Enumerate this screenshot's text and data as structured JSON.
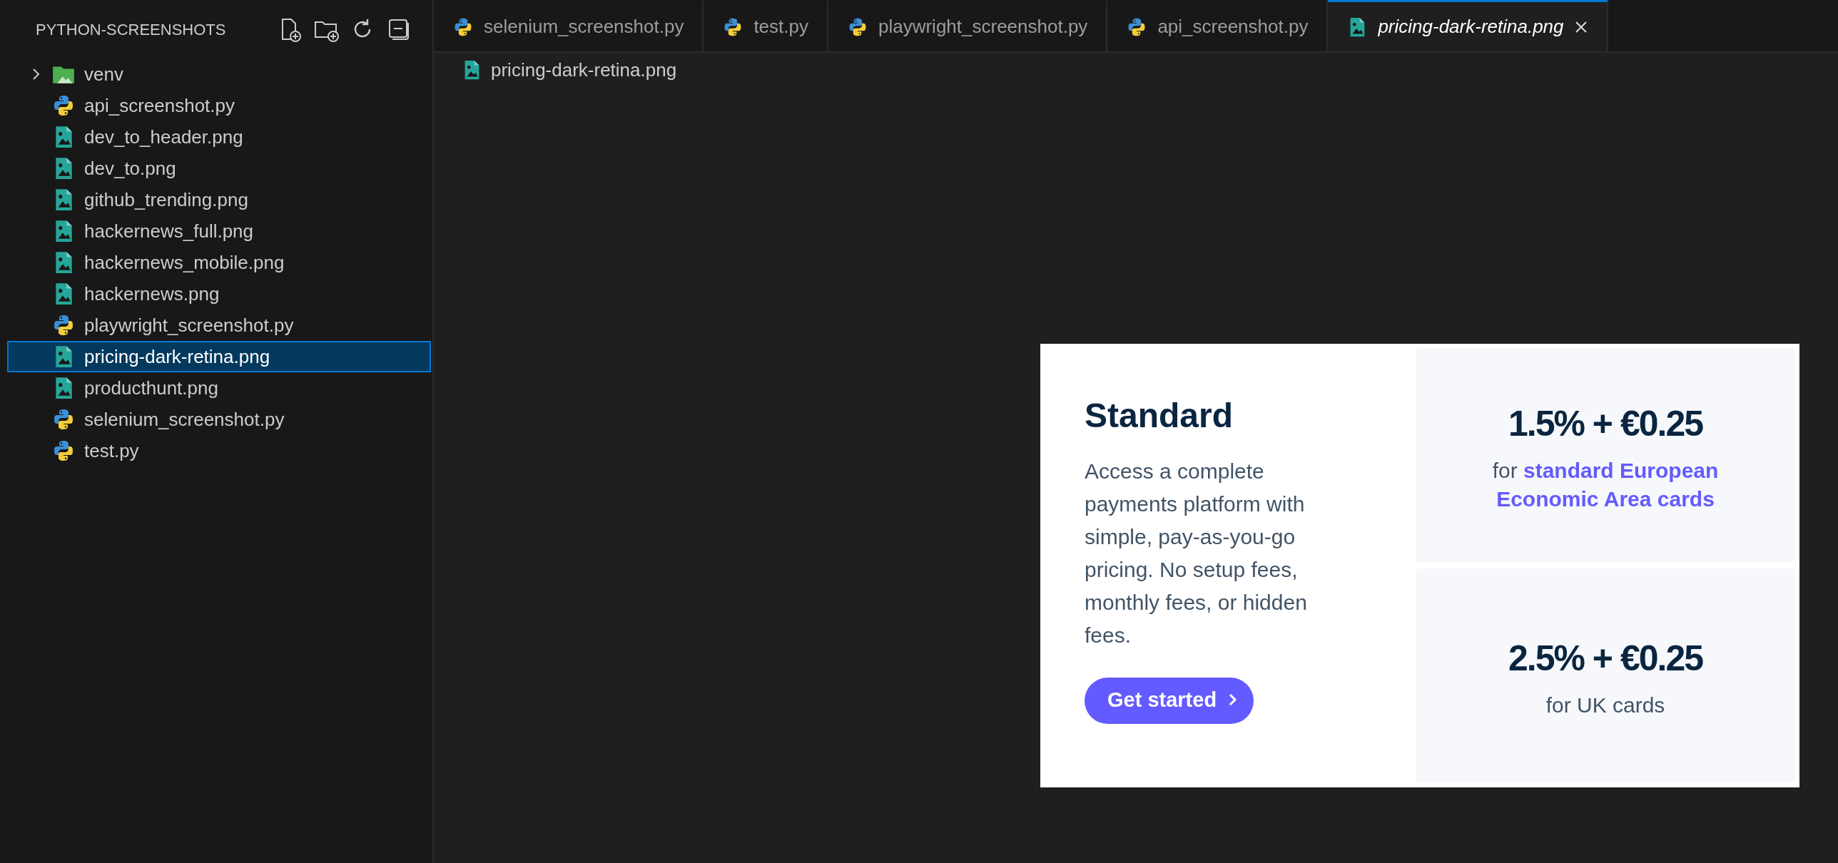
{
  "explorer": {
    "title": "PYTHON-SCREENSHOTS",
    "items": [
      {
        "name": "venv",
        "kind": "folder",
        "expanded": false,
        "selected": false
      },
      {
        "name": "api_screenshot.py",
        "kind": "python",
        "selected": false
      },
      {
        "name": "dev_to_header.png",
        "kind": "image",
        "selected": false
      },
      {
        "name": "dev_to.png",
        "kind": "image",
        "selected": false
      },
      {
        "name": "github_trending.png",
        "kind": "image",
        "selected": false
      },
      {
        "name": "hackernews_full.png",
        "kind": "image",
        "selected": false
      },
      {
        "name": "hackernews_mobile.png",
        "kind": "image",
        "selected": false
      },
      {
        "name": "hackernews.png",
        "kind": "image",
        "selected": false
      },
      {
        "name": "playwright_screenshot.py",
        "kind": "python",
        "selected": false
      },
      {
        "name": "pricing-dark-retina.png",
        "kind": "image",
        "selected": true
      },
      {
        "name": "producthunt.png",
        "kind": "image",
        "selected": false
      },
      {
        "name": "selenium_screenshot.py",
        "kind": "python",
        "selected": false
      },
      {
        "name": "test.py",
        "kind": "python",
        "selected": false
      }
    ]
  },
  "tabs": [
    {
      "label": "selenium_screenshot.py",
      "kind": "python",
      "selected": false,
      "preview": false
    },
    {
      "label": "test.py",
      "kind": "python",
      "selected": false,
      "preview": false
    },
    {
      "label": "playwright_screenshot.py",
      "kind": "python",
      "selected": false,
      "preview": false
    },
    {
      "label": "api_screenshot.py",
      "kind": "python",
      "selected": false,
      "preview": false
    },
    {
      "label": "pricing-dark-retina.png",
      "kind": "image",
      "selected": true,
      "preview": true
    }
  ],
  "breadcrumb": {
    "label": "pricing-dark-retina.png",
    "kind": "image"
  },
  "image": {
    "title": "Standard",
    "description": "Access a complete payments platform with simple, pay-as-you-go pricing. No setup fees, monthly fees, or hidden fees.",
    "button": "Get started",
    "prices": [
      {
        "amount": "1.5% + €0.25",
        "note": [
          {
            "text": "for",
            "link": false
          },
          {
            "text": "standard European",
            "link": true
          },
          {
            "text": "Economic Area cards",
            "link": true
          }
        ]
      },
      {
        "amount": "2.5% + €0.25",
        "note": [
          {
            "text": "for UK cards",
            "link": false
          }
        ]
      }
    ]
  }
}
